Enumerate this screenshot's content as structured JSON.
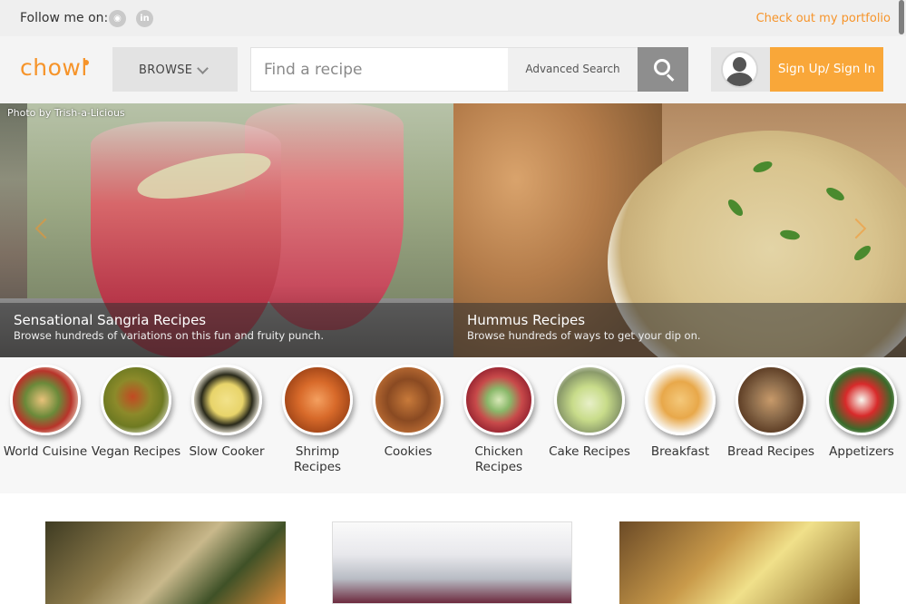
{
  "followbar": {
    "label": "Follow me on:",
    "social": [
      {
        "name": "github-icon",
        "glyph": "◉"
      },
      {
        "name": "linkedin-icon",
        "glyph": "in"
      }
    ],
    "portfolio_link": "Check out my portfolio"
  },
  "header": {
    "logo": "chowl",
    "browse_label": "BROWSE",
    "search_placeholder": "Find a recipe",
    "advanced_search": "Advanced Search",
    "signup_label": "Sign Up/ Sign In",
    "accent_color": "#f6942a"
  },
  "hero": {
    "photo_credit": "Photo by Trish-a-Licious",
    "slides": [
      {
        "title": "Sensational Sangria Recipes",
        "subtitle": "Browse hundreds of variations on this fun and fruity punch."
      },
      {
        "title": "Hummus Recipes",
        "subtitle": "Browse hundreds of ways to get your dip on."
      }
    ]
  },
  "categories": [
    {
      "label": "World Cuisine"
    },
    {
      "label": "Vegan Recipes"
    },
    {
      "label": "Slow Cooker"
    },
    {
      "label": "Shrimp Recipes"
    },
    {
      "label": "Cookies"
    },
    {
      "label": "Chicken Recipes"
    },
    {
      "label": "Cake Recipes"
    },
    {
      "label": "Breakfast"
    },
    {
      "label": "Bread Recipes"
    },
    {
      "label": "Appetizers"
    }
  ]
}
